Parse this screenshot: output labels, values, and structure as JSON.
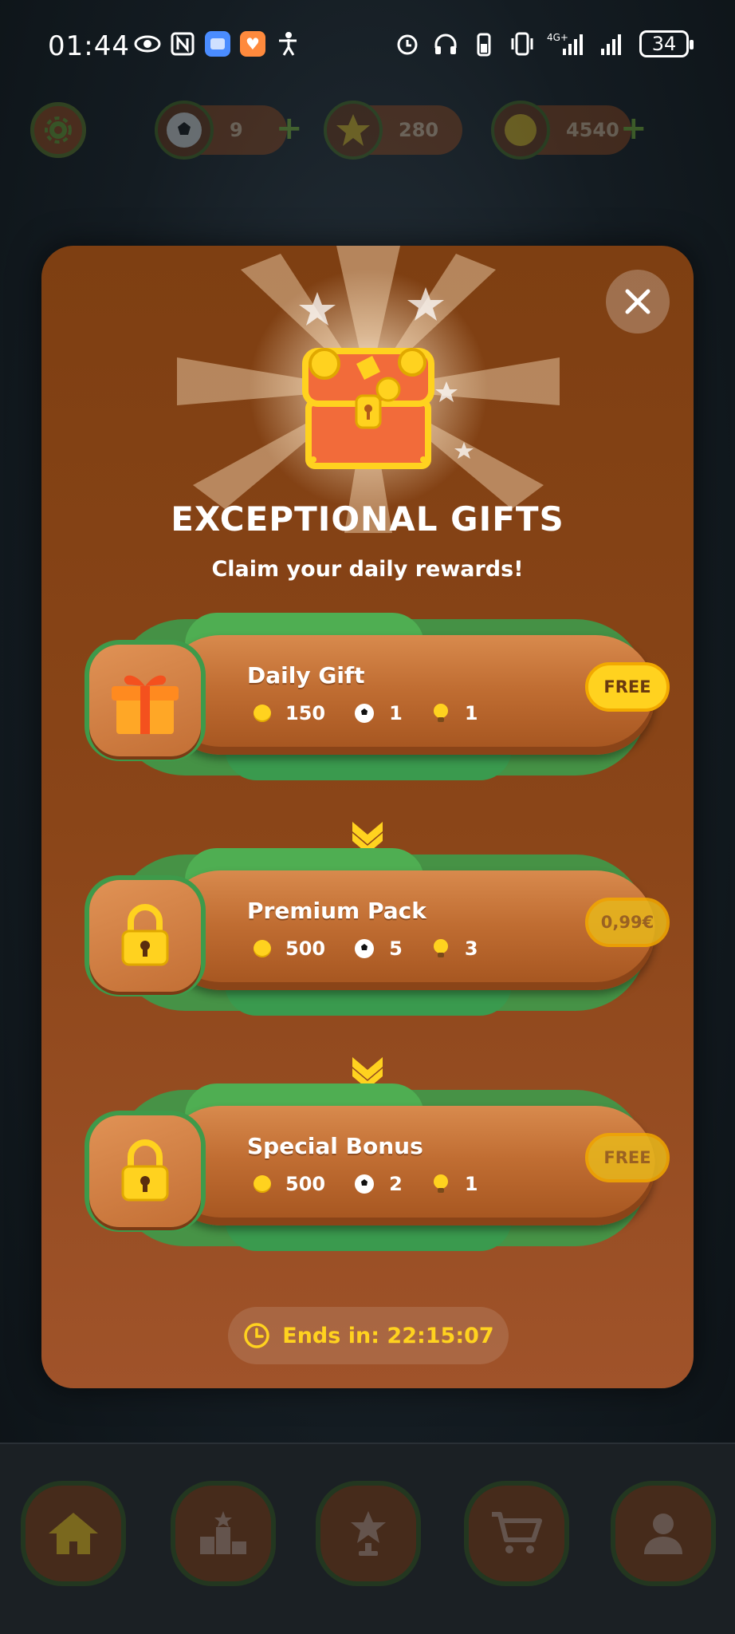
{
  "status_bar": {
    "time": "01:44",
    "battery": "34",
    "network": "4G+",
    "icons": [
      "eye-icon",
      "nfc-icon",
      "message-app-icon",
      "health-app-icon",
      "accessibility-icon",
      "alarm-icon",
      "headphones-icon",
      "battery-case-icon",
      "vibrate-icon",
      "signal-icon",
      "signal-icon"
    ]
  },
  "hud": {
    "balls": "9",
    "stars": "280",
    "coins": "4540"
  },
  "modal": {
    "title": "EXCEPTIONAL GIFTS",
    "subtitle": "Claim your daily rewards!",
    "close_icon": "close-icon",
    "rewards": [
      {
        "name": "Daily Gift",
        "coins": "150",
        "balls": "1",
        "hints": "1",
        "price": "FREE",
        "locked": false,
        "icon": "gift-icon"
      },
      {
        "name": "Premium Pack",
        "coins": "500",
        "balls": "5",
        "hints": "3",
        "price": "0,99€",
        "locked": true,
        "icon": "lock-icon"
      },
      {
        "name": "Special Bonus",
        "coins": "500",
        "balls": "2",
        "hints": "1",
        "price": "FREE",
        "locked": true,
        "icon": "lock-icon"
      }
    ],
    "timer": "Ends in: 22:15:07"
  },
  "bottom_nav": [
    "home-icon",
    "leaderboard-icon",
    "trophy-icon",
    "cart-icon",
    "profile-icon"
  ],
  "colors": {
    "accent": "#ffd21f",
    "modal": "#8a4518",
    "grass": "#3e9a4a"
  }
}
